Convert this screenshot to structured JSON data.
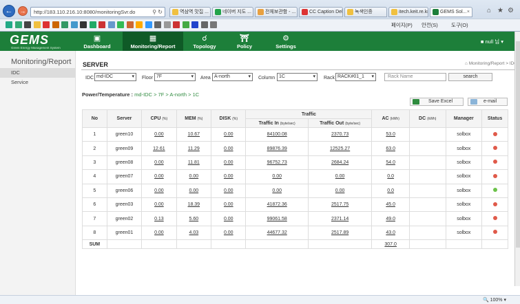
{
  "browser": {
    "url": "http://183.110.216.10:8080/monitoringSvr.do",
    "tabs": [
      {
        "label": "역삼역 맛집 ...",
        "color": "#f0c040"
      },
      {
        "label": "네이버 지도 ...",
        "color": "#22a34a"
      },
      {
        "label": "전체보관함 - ...",
        "color": "#e8a040"
      },
      {
        "label": "CC Caption Deli...",
        "color": "#d33"
      },
      {
        "label": "녹색인증",
        "color": "#f0c040"
      },
      {
        "label": "itech.keit.re.kr",
        "color": "#f0c040"
      },
      {
        "label": "GEMS Sol...",
        "color": "#1d7f3a"
      }
    ],
    "toolbar_items": [
      "페이지(P)",
      "안전(S)",
      "도구(O)"
    ],
    "zoom": "100%"
  },
  "header": {
    "logo": "GEMS",
    "logo_sub": "Green Energy Management System",
    "menus": [
      {
        "label": "Dashboard",
        "icon": "monitor-icon"
      },
      {
        "label": "Monitoring/Report",
        "icon": "chart-icon"
      },
      {
        "label": "Topology",
        "icon": "topology-icon"
      },
      {
        "label": "Policy",
        "icon": "building-icon"
      },
      {
        "label": "Settings",
        "icon": "gear-icon"
      }
    ],
    "user": "null 님"
  },
  "sidebar": {
    "title": "Monitoring/Report",
    "items": [
      "IDC",
      "Service"
    ]
  },
  "main": {
    "title": "SERVER",
    "breadcrumb": "Monitoring/Report > IDC",
    "filters": {
      "idc_label": "IDC",
      "idc_value": "md-IDC",
      "floor_label": "Floor",
      "floor_value": "7F",
      "area_label": "Area",
      "area_value": "A-north",
      "column_label": "Column",
      "column_value": "1C",
      "rack_label": "Rack",
      "rack_value": "RACK#01_1",
      "rack_name_placeholder": "Rack Name",
      "search_label": "search"
    },
    "pt_label": "Power/Temperature :",
    "pt_path": "md-IDC > 7F > A-north > 1C",
    "save_excel": "Save Excel",
    "email": "e-mail",
    "table": {
      "headers": {
        "no": "No",
        "server": "Server",
        "cpu": "CPU",
        "cpu_unit": "(%)",
        "mem": "MEM",
        "mem_unit": "(%)",
        "disk": "DISK",
        "disk_unit": "(%)",
        "traffic": "Traffic",
        "tin": "Traffic In",
        "tin_unit": "(byte/sec)",
        "tout": "Traffic Out",
        "tout_unit": "(byte/sec)",
        "ac": "AC",
        "ac_unit": "(kWh)",
        "dc": "DC",
        "dc_unit": "(kWh)",
        "manager": "Manager",
        "status": "Status"
      },
      "rows": [
        {
          "no": "1",
          "server": "green10",
          "cpu": "0.00",
          "mem": "10.67",
          "disk": "0.00",
          "tin": "84100.08",
          "tout": "2370.73",
          "ac": "53.0",
          "dc": "",
          "manager": "solbox",
          "status": "#e05a4a"
        },
        {
          "no": "2",
          "server": "green09",
          "cpu": "12.61",
          "mem": "11.29",
          "disk": "0.00",
          "tin": "89876.39",
          "tout": "12525.27",
          "ac": "63.0",
          "dc": "",
          "manager": "solbox",
          "status": "#e05a4a"
        },
        {
          "no": "3",
          "server": "green08",
          "cpu": "0.00",
          "mem": "11.81",
          "disk": "0.00",
          "tin": "96752.73",
          "tout": "2684.24",
          "ac": "54.0",
          "dc": "",
          "manager": "solbox",
          "status": "#e05a4a"
        },
        {
          "no": "4",
          "server": "green07",
          "cpu": "0.00",
          "mem": "0.00",
          "disk": "0.00",
          "tin": "0.00",
          "tout": "0.00",
          "ac": "0.0",
          "dc": "",
          "manager": "solbox",
          "status": "#e05a4a"
        },
        {
          "no": "5",
          "server": "green06",
          "cpu": "0.00",
          "mem": "0.00",
          "disk": "0.00",
          "tin": "0.00",
          "tout": "0.00",
          "ac": "0.0",
          "dc": "",
          "manager": "solbox",
          "status": "#6cc24a"
        },
        {
          "no": "6",
          "server": "green03",
          "cpu": "0.00",
          "mem": "18.39",
          "disk": "0.00",
          "tin": "41872.36",
          "tout": "2517.75",
          "ac": "45.0",
          "dc": "",
          "manager": "solbox",
          "status": "#e05a4a"
        },
        {
          "no": "7",
          "server": "green02",
          "cpu": "0.13",
          "mem": "5.60",
          "disk": "0.00",
          "tin": "99061.58",
          "tout": "2371.14",
          "ac": "49.0",
          "dc": "",
          "manager": "solbox",
          "status": "#e05a4a"
        },
        {
          "no": "8",
          "server": "green01",
          "cpu": "0.00",
          "mem": "4.03",
          "disk": "0.00",
          "tin": "44677.32",
          "tout": "2517.89",
          "ac": "43.0",
          "dc": "",
          "manager": "solbox",
          "status": "#e05a4a"
        }
      ],
      "sum_label": "SUM",
      "sum_ac": "307.0"
    }
  }
}
